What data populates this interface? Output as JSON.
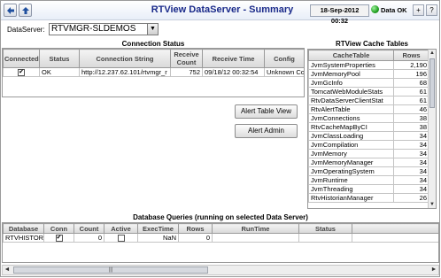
{
  "header": {
    "title": "RTView DataServer - Summary",
    "date": "18-Sep-2012 00:32",
    "status": "Data OK",
    "plus_label": "+",
    "help_label": "?"
  },
  "dataserver": {
    "label": "DataServer:",
    "selected": "RTVMGR-SLDEMOS"
  },
  "connection": {
    "title": "Connection Status",
    "columns": [
      "Connected",
      "Status",
      "Connection String",
      "Receive Count",
      "Receive Time",
      "Config"
    ],
    "row": {
      "connected": "✔",
      "status": "OK",
      "connection_string": "http://12.237.62.101/rtvmgr_r",
      "receive_count": "752",
      "receive_time": "09/18/12 00:32:54",
      "config": "Unknown Co"
    }
  },
  "buttons": {
    "alert_table": "Alert Table View",
    "alert_admin": "Alert Admin"
  },
  "cache": {
    "title": "RTView Cache Tables",
    "columns": [
      "CacheTable",
      "Rows"
    ],
    "rows": [
      {
        "name": "JvmSystemProperties",
        "rows": "2,190"
      },
      {
        "name": "JvmMemoryPool",
        "rows": "196"
      },
      {
        "name": "JvmGcInfo",
        "rows": "68"
      },
      {
        "name": "TomcatWebModuleStats",
        "rows": "61"
      },
      {
        "name": "RtvDataServerClientStat",
        "rows": "61"
      },
      {
        "name": "RtvAlertTable",
        "rows": "46"
      },
      {
        "name": "JvmConnections",
        "rows": "38"
      },
      {
        "name": "RtvCacheMapByCI",
        "rows": "38"
      },
      {
        "name": "JvmClassLoading",
        "rows": "34"
      },
      {
        "name": "JvmCompilation",
        "rows": "34"
      },
      {
        "name": "JvmMemory",
        "rows": "34"
      },
      {
        "name": "JvmMemoryManager",
        "rows": "34"
      },
      {
        "name": "JvmOperatingSystem",
        "rows": "34"
      },
      {
        "name": "JvmRuntime",
        "rows": "34"
      },
      {
        "name": "JvmThreading",
        "rows": "34"
      },
      {
        "name": "RtvHistorianManager",
        "rows": "26"
      }
    ]
  },
  "database": {
    "title": "Database Queries (running on selected Data Server)",
    "columns": [
      "Database",
      "Conn",
      "Count",
      "Active",
      "ExecTime",
      "Rows",
      "RunTime",
      "Status"
    ],
    "row": {
      "database": "RTVHISTORY",
      "conn": "✔",
      "count": "0",
      "active": "",
      "exec_time": "NaN",
      "rows": "0",
      "run_time": "",
      "status": ""
    }
  },
  "icons": {
    "back": "back-arrow-icon",
    "up": "up-arrow-icon",
    "status": "green-status-light-icon"
  },
  "colors": {
    "title_text": "#1a2a8a",
    "ok_light": "#22a022"
  }
}
